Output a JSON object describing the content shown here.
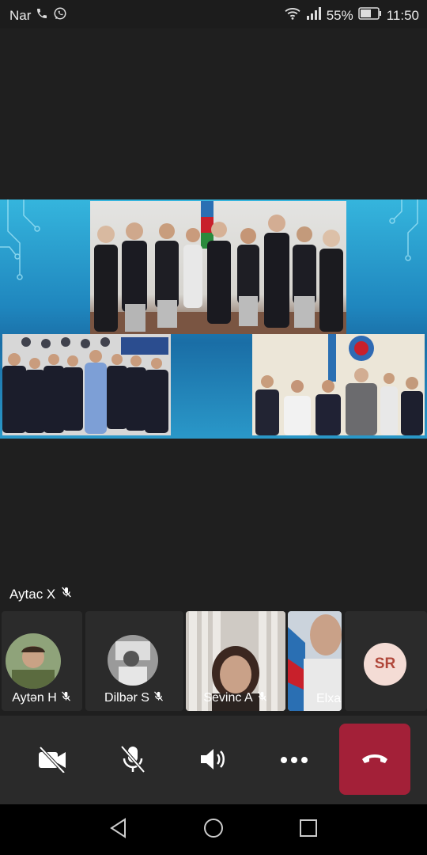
{
  "status_bar": {
    "carrier": "Nar",
    "battery_percent": "55%",
    "time": "11:50",
    "icons": [
      "phone-icon",
      "whatsapp-icon",
      "wifi-icon",
      "signal-icon",
      "battery-icon"
    ]
  },
  "local_participant": {
    "name": "Aytac X",
    "muted": true
  },
  "participants": [
    {
      "name": "Aytən H",
      "muted": true,
      "type": "photo-avatar"
    },
    {
      "name": "Dilbər S",
      "muted": true,
      "type": "photo-avatar"
    },
    {
      "name": "Sevinc A",
      "muted": true,
      "type": "video"
    },
    {
      "name": "Elxa",
      "muted": false,
      "type": "video"
    },
    {
      "name": "",
      "initials": "SR",
      "type": "initials-avatar"
    }
  ],
  "controls": {
    "items": [
      "camera-off-icon",
      "mic-off-icon",
      "speaker-icon",
      "more-icon",
      "hang-up-icon"
    ]
  },
  "navigation": {
    "items": [
      "back-icon",
      "home-icon",
      "recents-icon"
    ]
  },
  "colors": {
    "hangup": "#a32038",
    "background": "#1f1f1f",
    "initials_bg": "#f4dcd5",
    "initials_fg": "#b0473a"
  }
}
